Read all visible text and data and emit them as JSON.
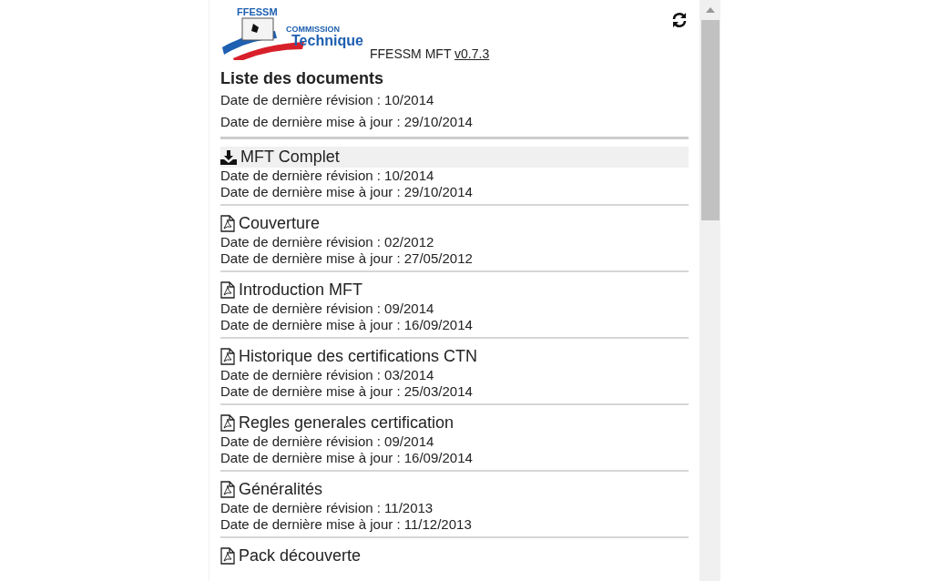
{
  "logo": {
    "brand": "FFESSM",
    "line_1": "COMMISSION",
    "line_2": "Technique"
  },
  "app": {
    "name": "FFESSM MFT",
    "version": "v0.7.3"
  },
  "header": {
    "title": "Liste des documents",
    "revision": "Date de dernière révision : 10/2014",
    "update": "Date de dernière mise à jour : 29/10/2014"
  },
  "documents": [
    {
      "kind": "download",
      "selected": true,
      "title": "MFT Complet",
      "revision": "Date de dernière révision : 10/2014",
      "update": "Date de dernière mise à jour : 29/10/2014"
    },
    {
      "kind": "pdf",
      "selected": false,
      "title": "Couverture",
      "revision": "Date de dernière révision : 02/2012",
      "update": "Date de dernière mise à jour : 27/05/2012"
    },
    {
      "kind": "pdf",
      "selected": false,
      "title": "Introduction MFT",
      "revision": "Date de dernière révision : 09/2014",
      "update": "Date de dernière mise à jour : 16/09/2014"
    },
    {
      "kind": "pdf",
      "selected": false,
      "title": "Historique des certifications CTN",
      "revision": "Date de dernière révision : 03/2014",
      "update": "Date de dernière mise à jour : 25/03/2014"
    },
    {
      "kind": "pdf",
      "selected": false,
      "title": "Regles generales certification",
      "revision": "Date de dernière révision : 09/2014",
      "update": "Date de dernière mise à jour : 16/09/2014"
    },
    {
      "kind": "pdf",
      "selected": false,
      "title": "Généralités",
      "revision": "Date de dernière révision : 11/2013",
      "update": "Date de dernière mise à jour : 11/12/2013"
    },
    {
      "kind": "pdf",
      "selected": false,
      "title": "Pack découverte"
    }
  ]
}
